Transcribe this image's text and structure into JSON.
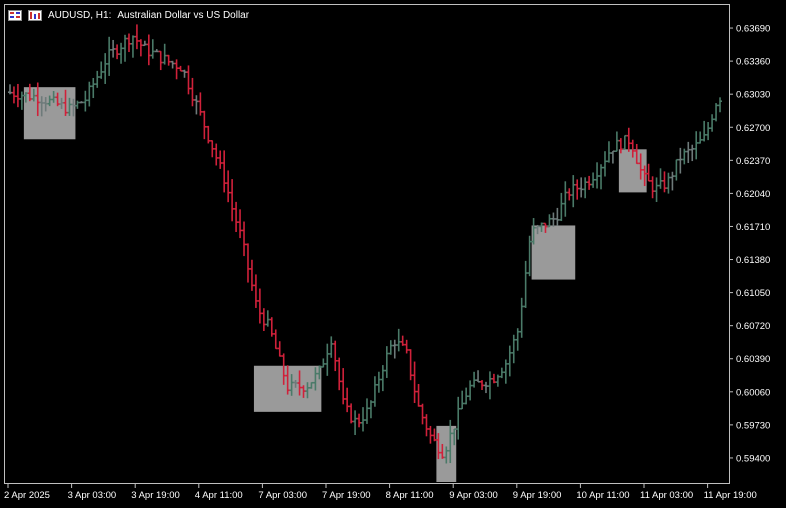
{
  "header": {
    "symbol_label": "AUDUSD, H1:",
    "description": "Australian Dollar vs US Dollar",
    "icons": [
      "chart-menu-icon",
      "timeframe-icon"
    ]
  },
  "colors": {
    "background": "#000000",
    "frame": "#bfbfbf",
    "text": "#ffffff",
    "bull": "#4a7a68",
    "bear": "#d0213a",
    "neutral": "#6e7a7a",
    "zone": "#9a9a9a"
  },
  "chart_data": {
    "type": "bar",
    "symbol": "AUDUSD",
    "timeframe": "H1",
    "ylim": [
      0.5915,
      0.6392
    ],
    "y_ticks": [
      "0.63690",
      "0.63360",
      "0.63030",
      "0.62700",
      "0.62370",
      "0.62040",
      "0.61710",
      "0.61380",
      "0.61050",
      "0.60720",
      "0.60390",
      "0.60060",
      "0.59730",
      "0.59400"
    ],
    "x_ticks": [
      "2 Apr 2025",
      "3 Apr 03:00",
      "3 Apr 19:00",
      "4 Apr 11:00",
      "7 Apr 03:00",
      "7 Apr 19:00",
      "8 Apr 11:00",
      "9 Apr 03:00",
      "9 Apr 19:00",
      "10 Apr 11:00",
      "11 Apr 03:00",
      "11 Apr 19:00"
    ],
    "bar_count": 180,
    "price_path": [
      [
        0,
        0.6305
      ],
      [
        10,
        0.63
      ],
      [
        14,
        0.6295
      ],
      [
        20,
        0.6288
      ],
      [
        25,
        0.6298
      ],
      [
        32,
        0.634
      ],
      [
        40,
        0.6362
      ],
      [
        44,
        0.6348
      ],
      [
        52,
        0.6335
      ],
      [
        56,
        0.633
      ],
      [
        62,
        0.6282
      ],
      [
        70,
        0.6215
      ],
      [
        72,
        0.619
      ],
      [
        75,
        0.616
      ],
      [
        80,
        0.609
      ],
      [
        84,
        0.607
      ],
      [
        90,
        0.601
      ],
      [
        96,
        0.6012
      ],
      [
        100,
        0.6025
      ],
      [
        104,
        0.606
      ],
      [
        108,
        0.599
      ],
      [
        112,
        0.5975
      ],
      [
        116,
        0.5988
      ],
      [
        120,
        0.6028
      ],
      [
        124,
        0.6058
      ],
      [
        128,
        0.6045
      ],
      [
        132,
        0.599
      ],
      [
        136,
        0.596
      ],
      [
        140,
        0.5945
      ],
      [
        148,
        0.601
      ],
      [
        156,
        0.602
      ],
      [
        160,
        0.6035
      ],
      [
        164,
        0.6068
      ],
      [
        168,
        0.6165
      ],
      [
        170,
        0.6168
      ],
      [
        176,
        0.618
      ],
      [
        180,
        0.6205
      ],
      [
        186,
        0.6215
      ],
      [
        190,
        0.623
      ],
      [
        194,
        0.625
      ],
      [
        200,
        0.6258
      ],
      [
        204,
        0.622
      ],
      [
        208,
        0.6208
      ],
      [
        212,
        0.6215
      ],
      [
        216,
        0.624
      ],
      [
        220,
        0.6248
      ],
      [
        224,
        0.626
      ],
      [
        228,
        0.63
      ]
    ],
    "zones": [
      {
        "i0": 4,
        "i1": 16,
        "high": 0.631,
        "low": 0.6258
      },
      {
        "i0": 62,
        "i1": 78,
        "high": 0.6032,
        "low": 0.5986
      },
      {
        "i0": 108,
        "i1": 112,
        "high": 0.5972,
        "low": 0.5916
      },
      {
        "i0": 132,
        "i1": 142,
        "high": 0.6172,
        "low": 0.6118
      },
      {
        "i0": 154,
        "i1": 160,
        "high": 0.6248,
        "low": 0.6205
      }
    ]
  }
}
